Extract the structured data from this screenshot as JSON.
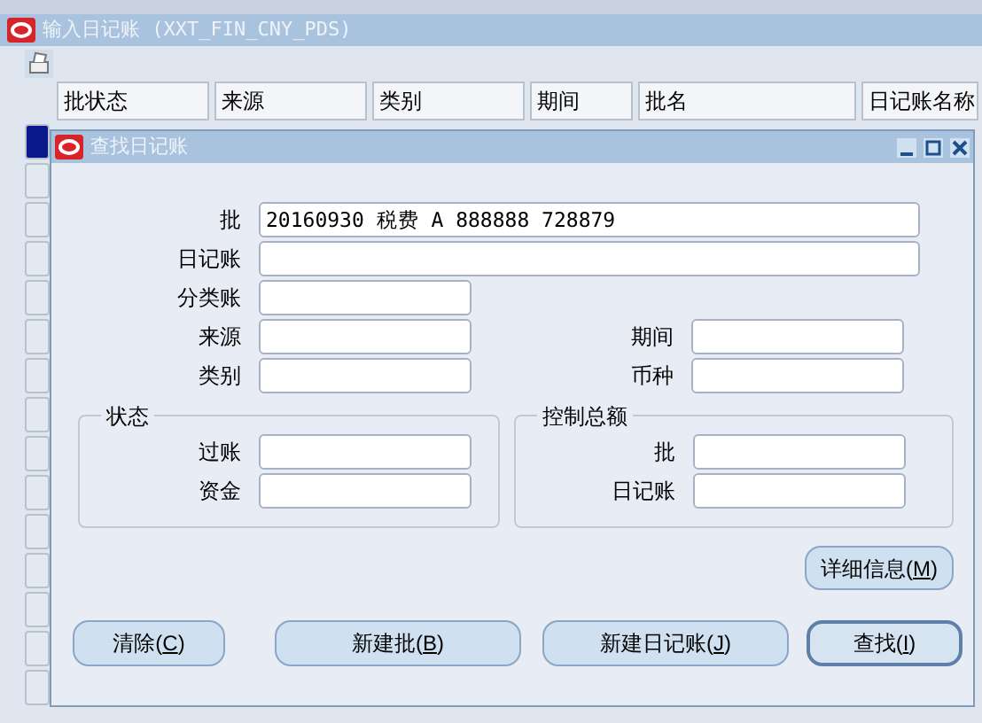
{
  "window": {
    "title": "输入日记账 (XXT_FIN_CNY_PDS)"
  },
  "table": {
    "columns": [
      "批状态",
      "来源",
      "类别",
      "期间",
      "批名",
      "日记账名称"
    ],
    "row_markers": [
      {
        "selected": true
      },
      {
        "selected": false
      },
      {
        "selected": false
      },
      {
        "selected": false
      },
      {
        "selected": false
      },
      {
        "selected": false
      },
      {
        "selected": false
      },
      {
        "selected": false
      },
      {
        "selected": false
      },
      {
        "selected": false
      },
      {
        "selected": false
      },
      {
        "selected": false
      },
      {
        "selected": false
      },
      {
        "selected": false
      },
      {
        "selected": false
      }
    ]
  },
  "dialog": {
    "title": "查找日记账",
    "rows": [
      [
        {
          "label": "批",
          "value": "20160930 税费 A 888888 728879",
          "kind": "wide"
        }
      ],
      [
        {
          "label": "日记账",
          "kind": "wide"
        }
      ],
      [
        {
          "label": "分类账",
          "kind": "short"
        }
      ],
      [
        {
          "label": "来源",
          "kind": "short"
        },
        {
          "label": "期间",
          "kind": "short"
        }
      ],
      [
        {
          "label": "类别",
          "kind": "short"
        },
        {
          "label": "币种",
          "kind": "short"
        }
      ]
    ],
    "groups": [
      {
        "title": "状态",
        "fields": [
          {
            "label": "过账"
          },
          {
            "label": "资金"
          }
        ]
      },
      {
        "title": "控制总额",
        "fields": [
          {
            "label": "批"
          },
          {
            "label": "日记账"
          }
        ]
      }
    ],
    "detail_button": "详细信息(M)",
    "buttons": [
      {
        "label": "清除(C)",
        "default": false
      },
      {
        "label": "新建批(B)",
        "default": false
      },
      {
        "label": "新建日记账(J)",
        "default": false
      },
      {
        "label": "查找(I)",
        "default": true
      }
    ]
  }
}
